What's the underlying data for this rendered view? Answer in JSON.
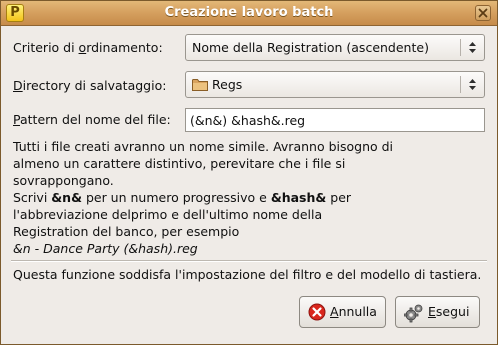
{
  "window": {
    "title": "Creazione lavoro batch",
    "app_icon_letter": "P"
  },
  "form": {
    "sort": {
      "label_pre": "Criterio di ",
      "label_mnemonic": "o",
      "label_post": "rdinamento:",
      "value": "Nome della Registration (ascendente)"
    },
    "directory": {
      "label_mnemonic": "D",
      "label_post": "irectory di salvataggio:",
      "value": "Regs",
      "icon": "folder-icon"
    },
    "pattern": {
      "label_mnemonic": "P",
      "label_post": "attern del nome del file:",
      "value": "(&n&) &hash&.reg"
    }
  },
  "description": {
    "line1": "Tutti i file creati avranno un nome simile. Avranno bisogno di",
    "line2": "almeno un carattere distintivo, perevitare che i file si",
    "line3": "sovrappongano.",
    "line4_a": "Scrivi ",
    "line4_b": "&n&",
    "line4_c": " per un numero progressivo e ",
    "line4_d": "&hash&",
    "line4_e": " per",
    "line5": "l'abbreviazione delprimo e dell'ultimo nome della",
    "line6": "Registration del banco, per esempio",
    "line7": "&n - Dance Party (&hash).reg"
  },
  "note": "Questa funzione soddisfa l'impostazione del filtro e del modello di tastiera.",
  "buttons": {
    "cancel": {
      "mnemonic": "A",
      "rest": "nnulla",
      "icon": "cancel-icon"
    },
    "execute": {
      "mnemonic": "E",
      "rest": "segui",
      "icon": "execute-icon"
    }
  },
  "colors": {
    "titlebar": "#d6a160",
    "background": "#efebe7",
    "cancel_icon": "#d9261c"
  }
}
